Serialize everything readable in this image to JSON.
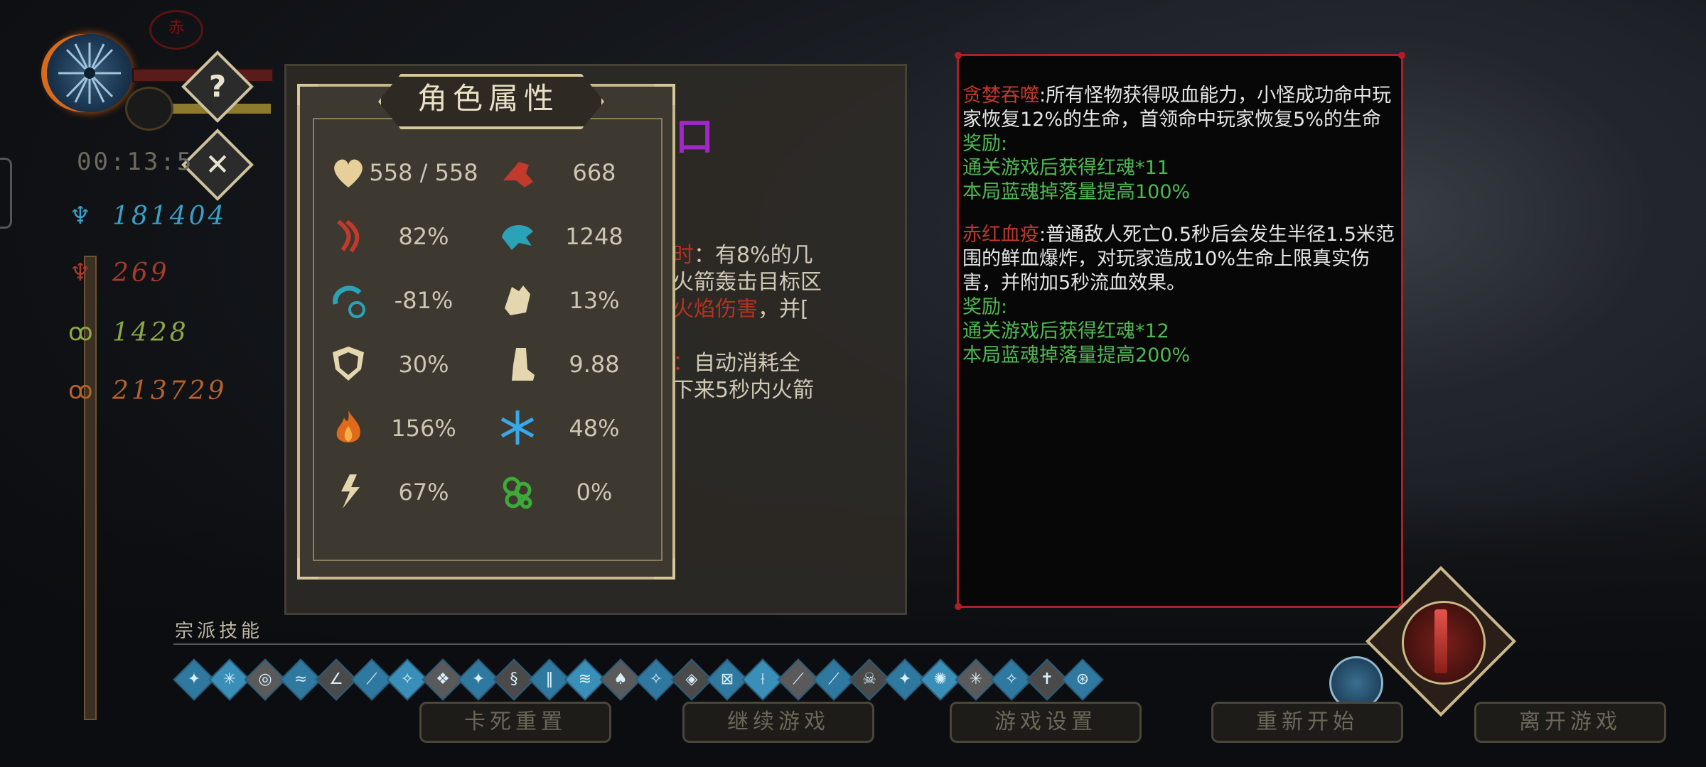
{
  "hud": {
    "timer": "00:13:5",
    "help_glyph": "?",
    "close_glyph": "✕",
    "seal_glyph": "赤",
    "resources": [
      {
        "icon": "blue-soul-icon",
        "value": "181404",
        "color": "#3aa0c8"
      },
      {
        "icon": "red-soul-icon",
        "value": "269",
        "color": "#a83a2a"
      },
      {
        "icon": "green-soul-icon",
        "value": "1428",
        "color": "#8da844"
      },
      {
        "icon": "orange-soul-icon",
        "value": "213729",
        "color": "#b5622b"
      }
    ]
  },
  "stats_panel": {
    "title": "角色属性",
    "stats": [
      {
        "icon": "heart-icon",
        "value": "558 / 558"
      },
      {
        "icon": "attack-fist-icon",
        "value": "668"
      },
      {
        "icon": "crit-slash-icon",
        "value": "82%"
      },
      {
        "icon": "crit-damage-icon",
        "value": "1248"
      },
      {
        "icon": "cooldown-icon",
        "value": "-81%"
      },
      {
        "icon": "dodge-hand-icon",
        "value": "13%"
      },
      {
        "icon": "shield-icon",
        "value": "30%"
      },
      {
        "icon": "boot-icon",
        "value": "9.88"
      },
      {
        "icon": "fire-icon",
        "value": "156%"
      },
      {
        "icon": "snowflake-icon",
        "value": "48%"
      },
      {
        "icon": "lightning-runner-icon",
        "value": "67%"
      },
      {
        "icon": "poison-icon",
        "value": "0%"
      }
    ]
  },
  "skill_desc": {
    "line1_red": "时",
    "line1": "：有8%的几",
    "line2": "火箭轰击目标区",
    "line3_red": "火焰伤害",
    "line3": "，并[",
    "line4_red": "：",
    "line4": "自动消耗全",
    "line5": "下来5秒内火箭",
    "title_fragment": "口"
  },
  "modifiers": {
    "items": [
      {
        "name": "贪婪吞噬",
        "desc": ":所有怪物获得吸血能力，小怪成功命中玩家恢复12%的生命，首领命中玩家恢复5%的生命",
        "reward_label": "奖励:",
        "rewards": [
          "通关游戏后获得红魂*11",
          "本局蓝魂掉落量提高100%"
        ]
      },
      {
        "name": "赤红血疫",
        "desc": ":普通敌人死亡0.5秒后会发生半径1.5米范围的鲜血爆炸，对玩家造成10%生命上限真实伤害，并附加5秒流血效果。",
        "reward_label": "奖励:",
        "rewards": [
          "通关游戏后获得红魂*12",
          "本局蓝魂掉落量提高200%"
        ]
      }
    ]
  },
  "bottom": {
    "section_label": "宗派技能",
    "skills": [
      "✦",
      "✳",
      "◎",
      "≈",
      "∠",
      "⟋",
      "✧",
      "❖",
      "✦",
      "§",
      "‖",
      "≋",
      "♠",
      "✧",
      "◈",
      "⊠",
      "⟊",
      "⟋",
      "⟋",
      "☠",
      "✦",
      "✺",
      "✳",
      "✧",
      "✝",
      "⊛"
    ],
    "buttons": [
      "卡死重置",
      "继续游戏",
      "游戏设置",
      "重新开始",
      "离开游戏"
    ]
  },
  "colors": {
    "panel_border": "#c9b98a",
    "modifier_border": "#b01f26",
    "reward_green": "#4fb852",
    "modifier_red": "#c0392b"
  }
}
